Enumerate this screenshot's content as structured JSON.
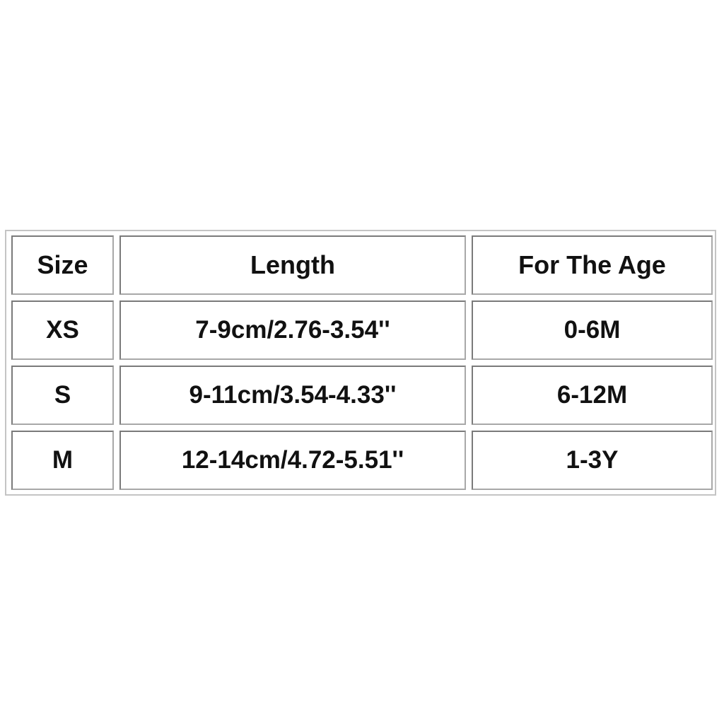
{
  "table": {
    "headers": [
      "Size",
      "Length",
      "For The Age"
    ],
    "rows": [
      [
        "XS",
        "7-9cm/2.76-3.54''",
        "0-6M"
      ],
      [
        "S",
        "9-11cm/3.54-4.33''",
        "6-12M"
      ],
      [
        "M",
        "12-14cm/4.72-5.51''",
        "1-3Y"
      ]
    ]
  }
}
